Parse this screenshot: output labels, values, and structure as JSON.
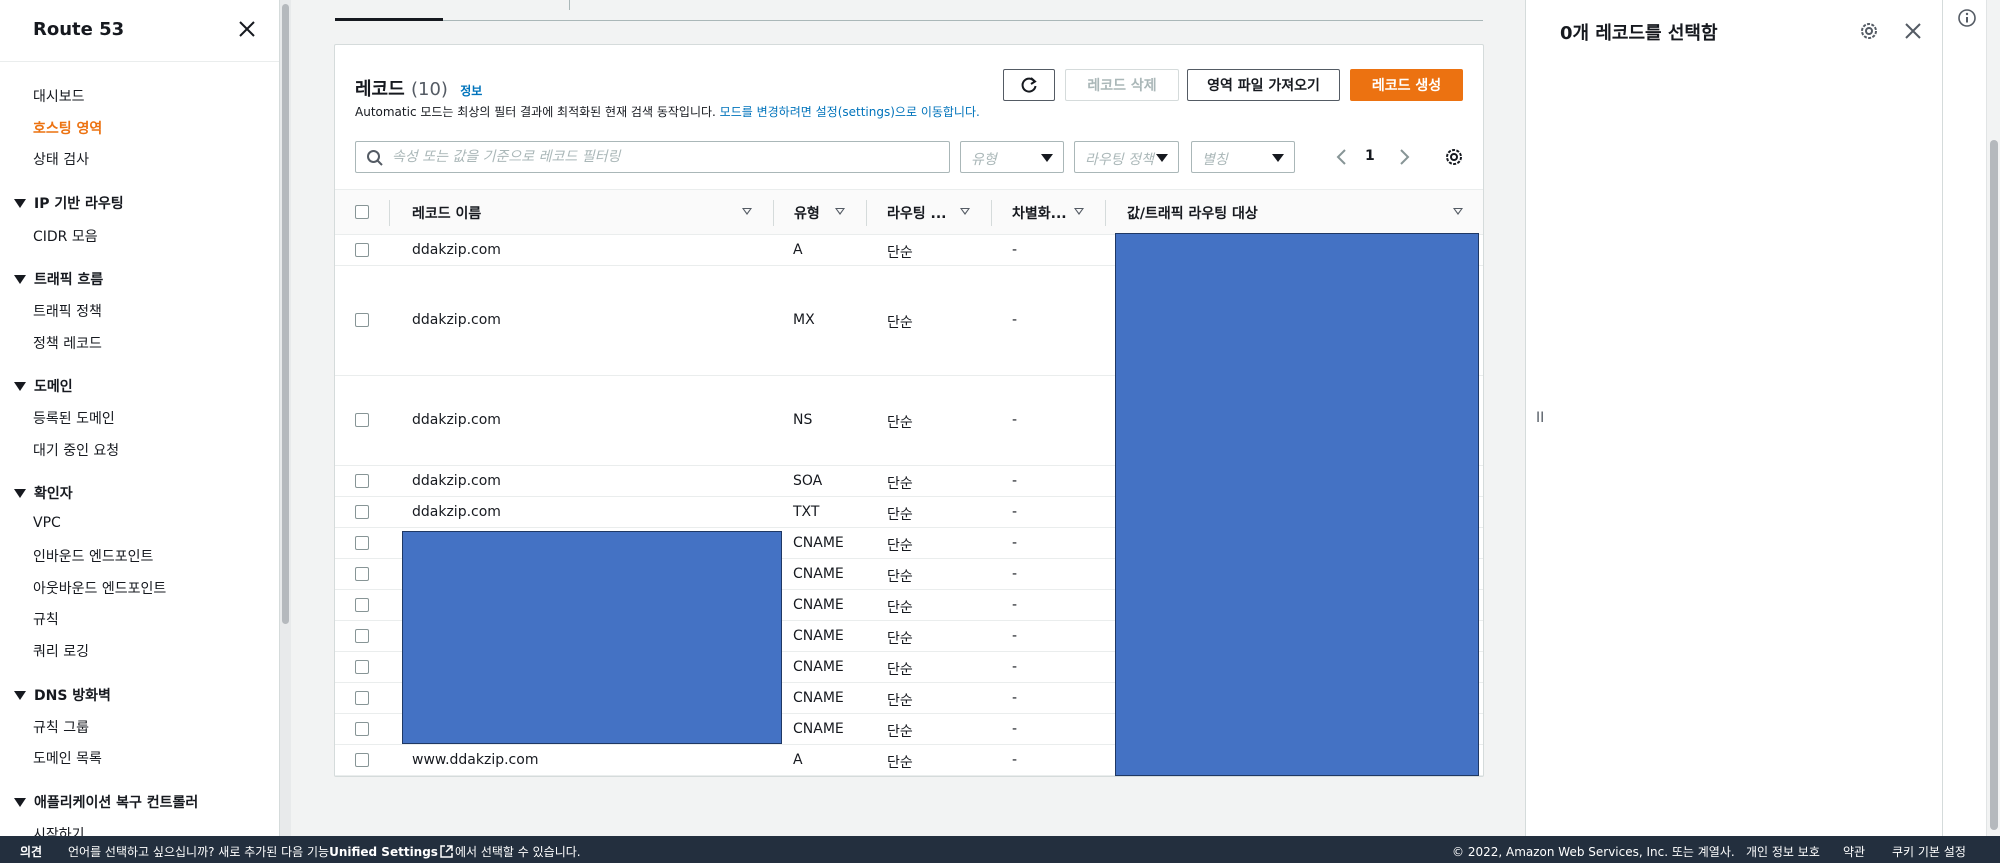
{
  "sidebar": {
    "title": "Route 53",
    "items": {
      "dashboard": "대시보드",
      "hosted_zones": "호스팅 영역",
      "health_checks": "상태 검사",
      "ip_routing": "IP 기반 라우팅",
      "cidr": "CIDR 모음",
      "traffic_flow": "트래픽 흐름",
      "traffic_policy": "트래픽 정책",
      "policy_records": "정책 레코드",
      "domains": "도메인",
      "registered_domains": "등록된 도메인",
      "pending_requests": "대기 중인 요청",
      "resolver": "확인자",
      "vpc": "VPC",
      "inbound": "인바운드 엔드포인트",
      "outbound": "아웃바운드 엔드포인트",
      "rules": "규칙",
      "query_logging": "쿼리 로깅",
      "dns_firewall": "DNS 방화벽",
      "rule_groups": "규칙 그룹",
      "domain_lists": "도메인 목록",
      "arc": "애플리케이션 복구 컨트롤러",
      "getting_started": "시작하기"
    }
  },
  "panel": {
    "title": "레코드",
    "count": "(10)",
    "info": "정보",
    "desc_prefix": "Automatic 모드는 최상의 필터 결과에 최적화된 현재 검색 동작입니다.",
    "desc_link": "모드를 변경하려면 설정(settings)으로 이동합니다.",
    "refresh_label": "",
    "delete_label": "레코드 삭제",
    "import_label": "영역 파일 가져오기",
    "create_label": "레코드 생성",
    "search_placeholder": "속성 또는 값을 기준으로 레코드 필터링",
    "filter_type": "유형",
    "filter_routing": "라우팅 정책",
    "filter_alias": "별칭",
    "page": "1"
  },
  "table": {
    "columns": {
      "name": "레코드 이름",
      "type": "유형",
      "routing": "라우팅 ...",
      "diff": "차별화...",
      "value": "값/트래픽 라우팅 대상"
    },
    "rows": [
      {
        "name": "ddakzip.com",
        "type": "A",
        "routing": "단순",
        "diff": "-"
      },
      {
        "name": "ddakzip.com",
        "type": "MX",
        "routing": "단순",
        "diff": "-"
      },
      {
        "name": "ddakzip.com",
        "type": "NS",
        "routing": "단순",
        "diff": "-"
      },
      {
        "name": "ddakzip.com",
        "type": "SOA",
        "routing": "단순",
        "diff": "-"
      },
      {
        "name": "ddakzip.com",
        "type": "TXT",
        "routing": "단순",
        "diff": "-"
      },
      {
        "name": "",
        "type": "CNAME",
        "routing": "단순",
        "diff": "-"
      },
      {
        "name": "",
        "type": "CNAME",
        "routing": "단순",
        "diff": "-"
      },
      {
        "name": "",
        "type": "CNAME",
        "routing": "단순",
        "diff": "-"
      },
      {
        "name": "",
        "type": "CNAME",
        "routing": "단순",
        "diff": "-"
      },
      {
        "name": "",
        "type": "CNAME",
        "routing": "단순",
        "diff": "-"
      },
      {
        "name": "",
        "type": "CNAME",
        "routing": "단순",
        "diff": "-"
      },
      {
        "name": "",
        "type": "CNAME",
        "routing": "단순",
        "diff": "-"
      },
      {
        "name": "www.ddakzip.com",
        "type": "A",
        "routing": "단순",
        "diff": "-"
      }
    ]
  },
  "split_panel": {
    "title": "0개 레코드를 선택함",
    "handle": "II"
  },
  "footer": {
    "feedback": "의견",
    "lang_prefix": "언어를 선택하고 싶으십니까? 새로 추가된 다음 기능",
    "lang_link": "Unified Settings",
    "lang_suffix": "에서 선택할 수 있습니다.",
    "copyright": "© 2022, Amazon Web Services, Inc. 또는 계열사.",
    "privacy": "개인 정보 보호",
    "terms": "약관",
    "cookies": "쿠키 기본 설정"
  },
  "colors": {
    "accent": "#ec7211",
    "link": "#0073bb",
    "redaction": "#4472c4",
    "footer_bg": "#232f3e"
  },
  "icons": [
    "close-icon",
    "refresh-icon",
    "search-icon",
    "chevron-left-icon",
    "chevron-right-icon",
    "gear-icon",
    "info-icon",
    "external-link-icon"
  ]
}
